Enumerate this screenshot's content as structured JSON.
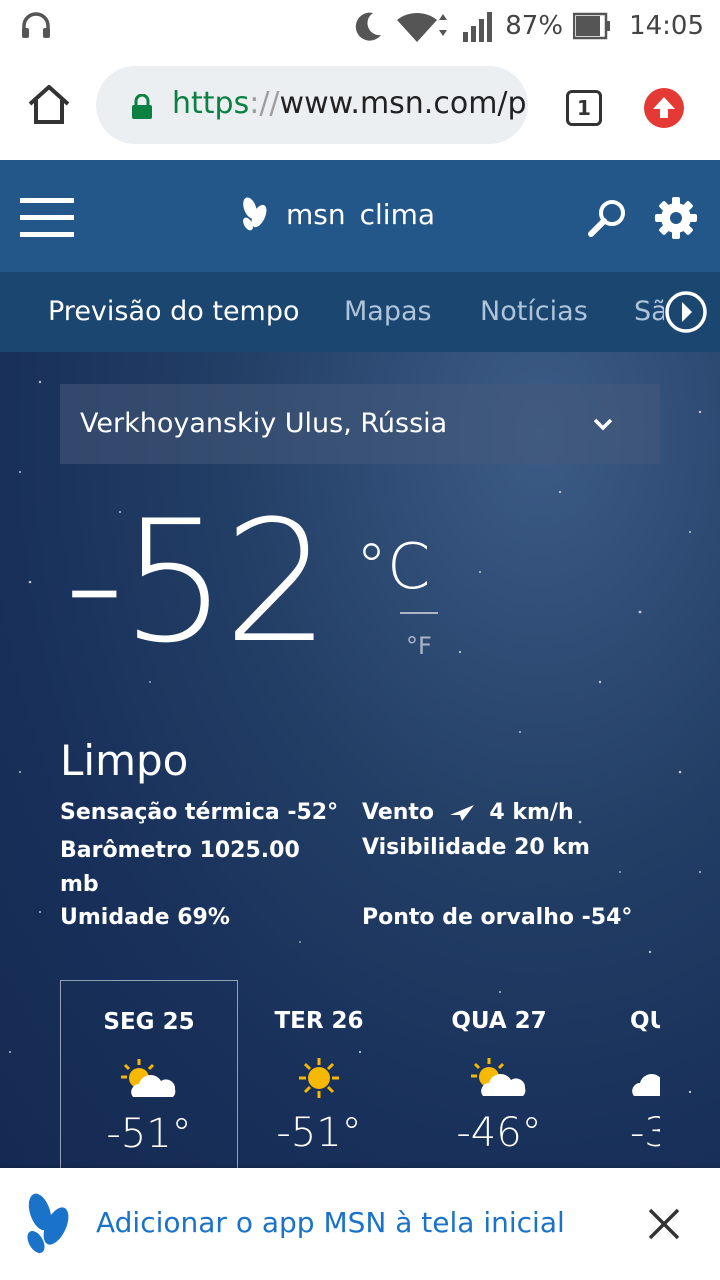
{
  "status_bar": {
    "battery": "87%",
    "time": "14:05"
  },
  "browser": {
    "url_scheme": "https",
    "url_sep": "://",
    "url_host": "www.msn.com/p",
    "tab_count": "1"
  },
  "header": {
    "brand": "msn",
    "section": "clima"
  },
  "nav": {
    "tabs": [
      {
        "label": "Previsão do tempo"
      },
      {
        "label": "Mapas"
      },
      {
        "label": "Notícias"
      },
      {
        "label": "Sã"
      }
    ]
  },
  "weather": {
    "location": "Verkhoyanskiy Ulus, Rússia",
    "temperature": "-52",
    "unit_active": "°C",
    "unit_alt": "°F",
    "condition": "Limpo",
    "details": {
      "feels_like": "Sensação térmica -52°",
      "wind_label": "Vento",
      "wind_value": "4 km/h",
      "barometer": "Barômetro 1025.00 mb",
      "visibility": "Visibilidade 20 km",
      "humidity": "Umidade 69%",
      "dew_point": "Ponto de orvalho -54°"
    }
  },
  "forecast": [
    {
      "day": "SEG 25",
      "temp": "-51°",
      "icon": "partly-sunny-icon"
    },
    {
      "day": "TER 26",
      "temp": "-51°",
      "icon": "sunny-icon"
    },
    {
      "day": "QUA 27",
      "temp": "-46°",
      "icon": "partly-sunny-icon"
    },
    {
      "day": "QU",
      "temp": "-3",
      "icon": "partly-sunny-icon"
    }
  ],
  "banner": {
    "text": "Adicionar o app MSN à tela inicial"
  },
  "colors": {
    "header_bg": "#23578a",
    "nav_bg": "#1b4670",
    "banner_text": "#1a73c8",
    "url_secure": "#0b8043",
    "update_red": "#e53935",
    "sun_yellow": "#f6b800"
  }
}
